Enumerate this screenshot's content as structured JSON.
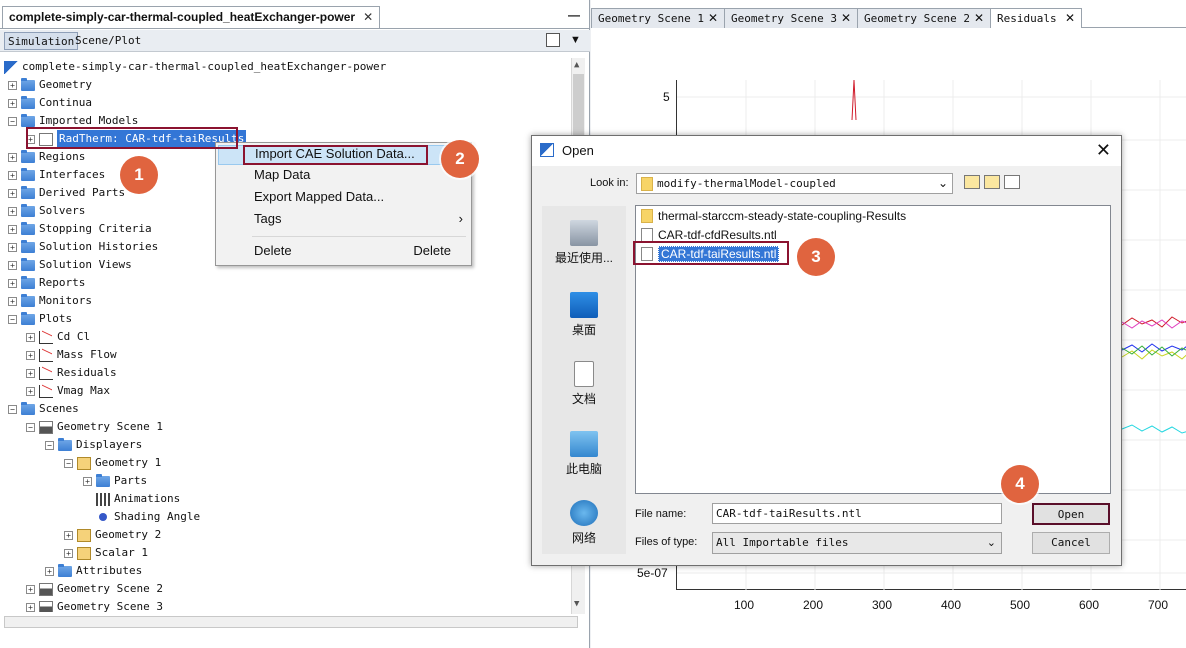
{
  "left_panel": {
    "tab_title": "complete-simply-car-thermal-coupled_heatExchanger-power",
    "subtabs": [
      "Simulation",
      "Scene/Plot"
    ],
    "tree": [
      {
        "label": "complete-simply-car-thermal-coupled_heatExchanger-power",
        "icon": "simulation-icon"
      },
      {
        "label": "Geometry",
        "icon": "folder-icon"
      },
      {
        "label": "Continua",
        "icon": "folder-icon"
      },
      {
        "label": "Imported Models",
        "icon": "folder-icon"
      },
      {
        "label": "RadTherm: CAR-tdf-taiResults",
        "icon": "mesh-icon"
      },
      {
        "label": "Regions",
        "icon": "folder-icon"
      },
      {
        "label": "Interfaces",
        "icon": "folder-icon"
      },
      {
        "label": "Derived Parts",
        "icon": "folder-icon"
      },
      {
        "label": "Solvers",
        "icon": "folder-icon"
      },
      {
        "label": "Stopping Criteria",
        "icon": "folder-icon"
      },
      {
        "label": "Solution Histories",
        "icon": "folder-icon"
      },
      {
        "label": "Solution Views",
        "icon": "folder-icon"
      },
      {
        "label": "Reports",
        "icon": "folder-icon"
      },
      {
        "label": "Monitors",
        "icon": "folder-icon"
      },
      {
        "label": "Plots",
        "icon": "folder-icon"
      },
      {
        "label": "Cd Cl",
        "icon": "plot-icon"
      },
      {
        "label": "Mass Flow",
        "icon": "plot-icon"
      },
      {
        "label": "Residuals",
        "icon": "plot-icon"
      },
      {
        "label": "Vmag Max",
        "icon": "plot-icon"
      },
      {
        "label": "Scenes",
        "icon": "folder-icon"
      },
      {
        "label": "Geometry Scene 1",
        "icon": "scene-icon"
      },
      {
        "label": "Displayers",
        "icon": "folder-icon"
      },
      {
        "label": "Geometry 1",
        "icon": "geometry-displayer-icon"
      },
      {
        "label": "Parts",
        "icon": "folder-icon"
      },
      {
        "label": "Animations",
        "icon": "animation-icon"
      },
      {
        "label": "Shading Angle",
        "icon": "dot-icon"
      },
      {
        "label": "Geometry 2",
        "icon": "geometry-displayer-icon"
      },
      {
        "label": "Scalar 1",
        "icon": "scalar-displayer-icon"
      },
      {
        "label": "Attributes",
        "icon": "folder-icon"
      },
      {
        "label": "Geometry Scene 2",
        "icon": "scene-icon"
      },
      {
        "label": "Geometry Scene 3",
        "icon": "scene-icon"
      }
    ]
  },
  "context_menu": {
    "items": [
      {
        "label": "Import CAE Solution Data...",
        "shortcut": ""
      },
      {
        "label": "Map Data",
        "shortcut": ""
      },
      {
        "label": "Export Mapped Data...",
        "shortcut": ""
      },
      {
        "label": "Tags",
        "shortcut": "›"
      },
      {
        "label": "Delete",
        "shortcut": "Delete"
      }
    ]
  },
  "right_panel": {
    "tabs": [
      "Geometry Scene 1",
      "Geometry Scene 3",
      "Geometry Scene 2",
      "Residuals"
    ],
    "active_tab": "Residuals"
  },
  "chart_data": {
    "type": "line",
    "title": "",
    "xlabel": "",
    "ylabel": "",
    "x_ticks": [
      100,
      200,
      300,
      400,
      500,
      600,
      700
    ],
    "y_ticks_visible": [
      "5",
      "5e-07"
    ],
    "y_scale": "log",
    "grid": true
  },
  "dialog": {
    "title": "Open",
    "look_in_label": "Look in:",
    "look_in_value": "modify-thermalModel-coupled",
    "places": [
      "最近使用...",
      "桌面",
      "文档",
      "此电脑",
      "网络"
    ],
    "files": [
      {
        "name": "thermal-starccm-steady-state-coupling-Results",
        "type": "folder"
      },
      {
        "name": "CAR-tdf-cfdResults.ntl",
        "type": "file"
      },
      {
        "name": "CAR-tdf-taiResults.ntl",
        "type": "file",
        "selected": true
      }
    ],
    "file_name_label": "File name:",
    "file_name_value": "CAR-tdf-taiResults.ntl",
    "files_of_type_label": "Files of type:",
    "files_of_type_value": "All Importable files",
    "open_button": "Open",
    "cancel_button": "Cancel"
  },
  "annotations": {
    "badges": [
      "1",
      "2",
      "3",
      "4"
    ]
  }
}
